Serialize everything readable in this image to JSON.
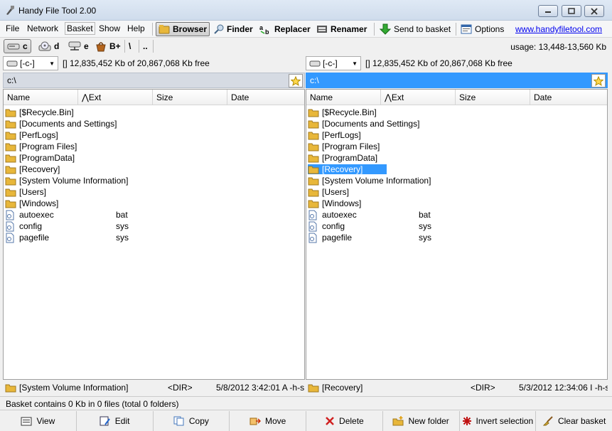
{
  "window": {
    "title": "Handy File Tool 2.00"
  },
  "menu": [
    "File",
    "Network",
    "Basket",
    "Show",
    "Help"
  ],
  "toolbar": {
    "browser": "Browser",
    "finder": "Finder",
    "replacer": "Replacer",
    "renamer": "Renamer",
    "send_to_basket": "Send to basket",
    "options": "Options",
    "website": "www.handyfiletool.com"
  },
  "drives": [
    "c",
    "d",
    "e",
    "B+",
    "\\",
    ".."
  ],
  "usage": "usage: 13,448-13,560 Kb",
  "columns": {
    "name": "Name",
    "ext": "Ext",
    "size": "Size",
    "date": "Date"
  },
  "left": {
    "drive": "[-c-]",
    "free": "[] 12,835,452 Kb of 20,867,068 Kb free",
    "path": "c:\\",
    "status": {
      "name": "[System Volume Information]",
      "dir": "<DIR>",
      "date": "5/8/2012 3:42:01 A  -h-s"
    }
  },
  "right": {
    "drive": "[-c-]",
    "free": "[] 12,835,452 Kb of 20,867,068 Kb free",
    "path": "c:\\",
    "status": {
      "name": "[Recovery]",
      "dir": "<DIR>",
      "date": "5/3/2012 12:34:06 I  -h-s"
    }
  },
  "files": [
    {
      "name": "[$Recycle.Bin]",
      "ext": "",
      "type": "folder"
    },
    {
      "name": "[Documents and Settings]",
      "ext": "",
      "type": "folder"
    },
    {
      "name": "[PerfLogs]",
      "ext": "",
      "type": "folder"
    },
    {
      "name": "[Program Files]",
      "ext": "",
      "type": "folder"
    },
    {
      "name": "[ProgramData]",
      "ext": "",
      "type": "folder"
    },
    {
      "name": "[Recovery]",
      "ext": "",
      "type": "folder"
    },
    {
      "name": "[System Volume Information]",
      "ext": "",
      "type": "folder"
    },
    {
      "name": "[Users]",
      "ext": "",
      "type": "folder"
    },
    {
      "name": "[Windows]",
      "ext": "",
      "type": "folder"
    },
    {
      "name": "autoexec",
      "ext": "bat",
      "type": "file"
    },
    {
      "name": "config",
      "ext": "sys",
      "type": "file"
    },
    {
      "name": "pagefile",
      "ext": "sys",
      "type": "file"
    }
  ],
  "right_selected": "[Recovery]",
  "basket_status": "Basket contains 0 Kb in 0 files (total 0 folders)",
  "bottom_buttons": [
    "View",
    "Edit",
    "Copy",
    "Move",
    "Delete",
    "New folder",
    "Invert selection",
    "Clear basket"
  ],
  "colors": {
    "selection": "#3399ff",
    "folder": "#e8b73a",
    "link": "#0000ee"
  }
}
